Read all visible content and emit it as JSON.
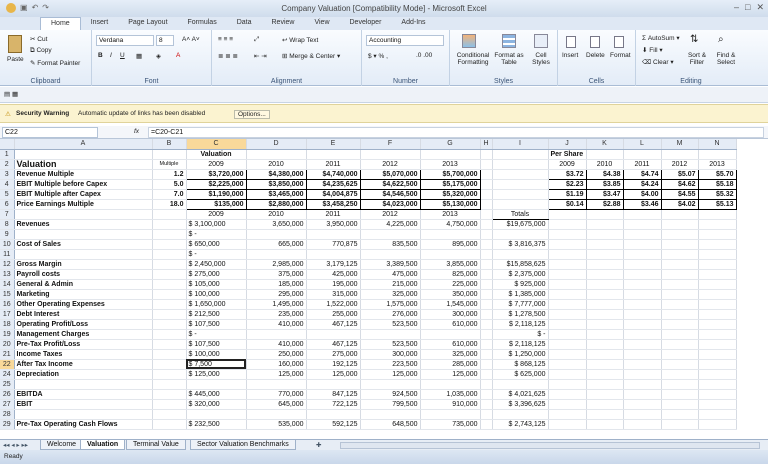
{
  "window": {
    "title": "Company Valuation  [Compatibility Mode] - Microsoft Excel"
  },
  "tabs": [
    "Home",
    "Insert",
    "Page Layout",
    "Formulas",
    "Data",
    "Review",
    "View",
    "Developer",
    "Add-Ins"
  ],
  "ribbon": {
    "clipboard": {
      "paste": "Paste",
      "cut": "Cut",
      "copy": "Copy",
      "format_painter": "Format Painter",
      "label": "Clipboard"
    },
    "font": {
      "name": "Verdana",
      "size": "8",
      "label": "Font"
    },
    "alignment": {
      "wrap": "Wrap Text",
      "merge": "Merge & Center",
      "label": "Alignment"
    },
    "number": {
      "format": "Accounting",
      "label": "Number"
    },
    "styles": {
      "conditional": "Conditional Formatting",
      "format_table": "Format as Table",
      "cell_styles": "Cell Styles",
      "label": "Styles"
    },
    "cells": {
      "insert": "Insert",
      "delete": "Delete",
      "format": "Format",
      "label": "Cells"
    },
    "editing": {
      "autosum": "AutoSum",
      "fill": "Fill",
      "clear": "Clear",
      "sort": "Sort & Filter",
      "find": "Find & Select",
      "label": "Editing"
    }
  },
  "security": {
    "title": "Security Warning",
    "message": "Automatic update of links has been disabled",
    "options": "Options..."
  },
  "formula_bar": {
    "name_box": "C22",
    "fx": "fx",
    "formula": "=C20-C21"
  },
  "columns": [
    "A",
    "B",
    "C",
    "D",
    "E",
    "F",
    "G",
    "H",
    "I",
    "J",
    "K",
    "L",
    "M",
    "N"
  ],
  "rows": [
    [
      "1",
      "",
      "",
      "Valuation",
      "",
      "",
      "",
      "",
      "",
      "",
      "Per Share",
      "",
      "",
      "",
      ""
    ],
    [
      "2",
      "Valuation",
      "Multiple",
      "2009",
      "2010",
      "2011",
      "2012",
      "2013",
      "",
      "",
      "2009",
      "2010",
      "2011",
      "2012",
      "2013"
    ],
    [
      "3",
      "Revenue Multiple",
      "1.2",
      "$3,720,000",
      "$4,380,000",
      "$4,740,000",
      "$5,070,000",
      "$5,700,000",
      "",
      "",
      "$3.72",
      "$4.38",
      "$4.74",
      "$5.07",
      "$5.70"
    ],
    [
      "4",
      "EBIT Multiple before Capex",
      "5.0",
      "$2,225,000",
      "$3,850,000",
      "$4,235,625",
      "$4,622,500",
      "$5,175,000",
      "",
      "",
      "$2.23",
      "$3.85",
      "$4.24",
      "$4.62",
      "$5.18"
    ],
    [
      "5",
      "EBIT Multiple after Capex",
      "7.0",
      "$1,190,000",
      "$3,465,000",
      "$4,004,875",
      "$4,546,500",
      "$5,320,000",
      "",
      "",
      "$1.19",
      "$3.47",
      "$4.00",
      "$4.55",
      "$5.32"
    ],
    [
      "6",
      "Price Earnings Multiple",
      "18.0",
      "$135,000",
      "$2,880,000",
      "$3,458,250",
      "$4,023,000",
      "$5,130,000",
      "",
      "",
      "$0.14",
      "$2.88",
      "$3.46",
      "$4.02",
      "$5.13"
    ],
    [
      "7",
      "",
      "",
      "2009",
      "2010",
      "2011",
      "2012",
      "2013",
      "",
      "Totals",
      "",
      "",
      "",
      "",
      ""
    ],
    [
      "8",
      "Revenues",
      "",
      "$    3,100,000",
      "3,650,000",
      "3,950,000",
      "4,225,000",
      "4,750,000",
      "",
      "$19,675,000",
      "",
      "",
      "",
      "",
      ""
    ],
    [
      "9",
      "",
      "",
      "$              -",
      "",
      "",
      "",
      "",
      "",
      "",
      "",
      "",
      "",
      "",
      ""
    ],
    [
      "10",
      "Cost of Sales",
      "",
      "$      650,000",
      "665,000",
      "770,875",
      "835,500",
      "895,000",
      "",
      "$  3,816,375",
      "",
      "",
      "",
      "",
      ""
    ],
    [
      "11",
      "",
      "",
      "$              -",
      "",
      "",
      "",
      "",
      "",
      "",
      "",
      "",
      "",
      "",
      ""
    ],
    [
      "12",
      "Gross Margin",
      "",
      "$    2,450,000",
      "2,985,000",
      "3,179,125",
      "3,389,500",
      "3,855,000",
      "",
      "$15,858,625",
      "",
      "",
      "",
      "",
      ""
    ],
    [
      "13",
      "Payroll costs",
      "",
      "$      275,000",
      "375,000",
      "425,000",
      "475,000",
      "825,000",
      "",
      "$  2,375,000",
      "",
      "",
      "",
      "",
      ""
    ],
    [
      "14",
      "General & Admin",
      "",
      "$      105,000",
      "185,000",
      "195,000",
      "215,000",
      "225,000",
      "",
      "$    925,000",
      "",
      "",
      "",
      "",
      ""
    ],
    [
      "15",
      "Marketing",
      "",
      "$      100,000",
      "295,000",
      "315,000",
      "325,000",
      "350,000",
      "",
      "$  1,385,000",
      "",
      "",
      "",
      "",
      ""
    ],
    [
      "16",
      "Other Operating Expenses",
      "",
      "$    1,650,000",
      "1,495,000",
      "1,522,000",
      "1,575,000",
      "1,545,000",
      "",
      "$  7,777,000",
      "",
      "",
      "",
      "",
      ""
    ],
    [
      "17",
      "Debt Interest",
      "",
      "$      212,500",
      "235,000",
      "255,000",
      "276,000",
      "300,000",
      "",
      "$  1,278,500",
      "",
      "",
      "",
      "",
      ""
    ],
    [
      "18",
      "Operating Profit/Loss",
      "",
      "$      107,500",
      "410,000",
      "467,125",
      "523,500",
      "610,000",
      "",
      "$  2,118,125",
      "",
      "",
      "",
      "",
      ""
    ],
    [
      "19",
      "Management Charges",
      "",
      "$              -",
      "",
      "",
      "",
      "",
      "",
      "$              -",
      "",
      "",
      "",
      "",
      ""
    ],
    [
      "20",
      "Pre-Tax Profit/Loss",
      "",
      "$      107,500",
      "410,000",
      "467,125",
      "523,500",
      "610,000",
      "",
      "$  2,118,125",
      "",
      "",
      "",
      "",
      ""
    ],
    [
      "21",
      "Income Taxes",
      "",
      "$      100,000",
      "250,000",
      "275,000",
      "300,000",
      "325,000",
      "",
      "$  1,250,000",
      "",
      "",
      "",
      "",
      ""
    ],
    [
      "22",
      "After Tax Income",
      "",
      "$          7,500",
      "160,000",
      "192,125",
      "223,500",
      "285,000",
      "",
      "$    868,125",
      "",
      "",
      "",
      "",
      ""
    ],
    [
      "24",
      "Depreciation",
      "",
      "$      125,000",
      "125,000",
      "125,000",
      "125,000",
      "125,000",
      "",
      "$    625,000",
      "",
      "",
      "",
      "",
      ""
    ],
    [
      "25",
      "",
      "",
      "",
      "",
      "",
      "",
      "",
      "",
      "",
      "",
      "",
      "",
      "",
      ""
    ],
    [
      "26",
      "EBITDA",
      "",
      "$      445,000",
      "770,000",
      "847,125",
      "924,500",
      "1,035,000",
      "",
      "$  4,021,625",
      "",
      "",
      "",
      "",
      ""
    ],
    [
      "27",
      "EBIT",
      "",
      "$      320,000",
      "645,000",
      "722,125",
      "799,500",
      "910,000",
      "",
      "$  3,396,625",
      "",
      "",
      "",
      "",
      ""
    ],
    [
      "28",
      "",
      "",
      "",
      "",
      "",
      "",
      "",
      "",
      "",
      "",
      "",
      "",
      "",
      ""
    ],
    [
      "29",
      "Pre-Tax Operating Cash Flows",
      "",
      "$      232,500",
      "535,000",
      "592,125",
      "648,500",
      "735,000",
      "",
      "$  2,743,125",
      "",
      "",
      "",
      "",
      ""
    ]
  ],
  "sheets": [
    "Welcome",
    "Valuation",
    "Terminal Value",
    "Sector Valuation Benchmarks"
  ],
  "active_sheet": "Valuation",
  "status": {
    "ready": "Ready"
  }
}
